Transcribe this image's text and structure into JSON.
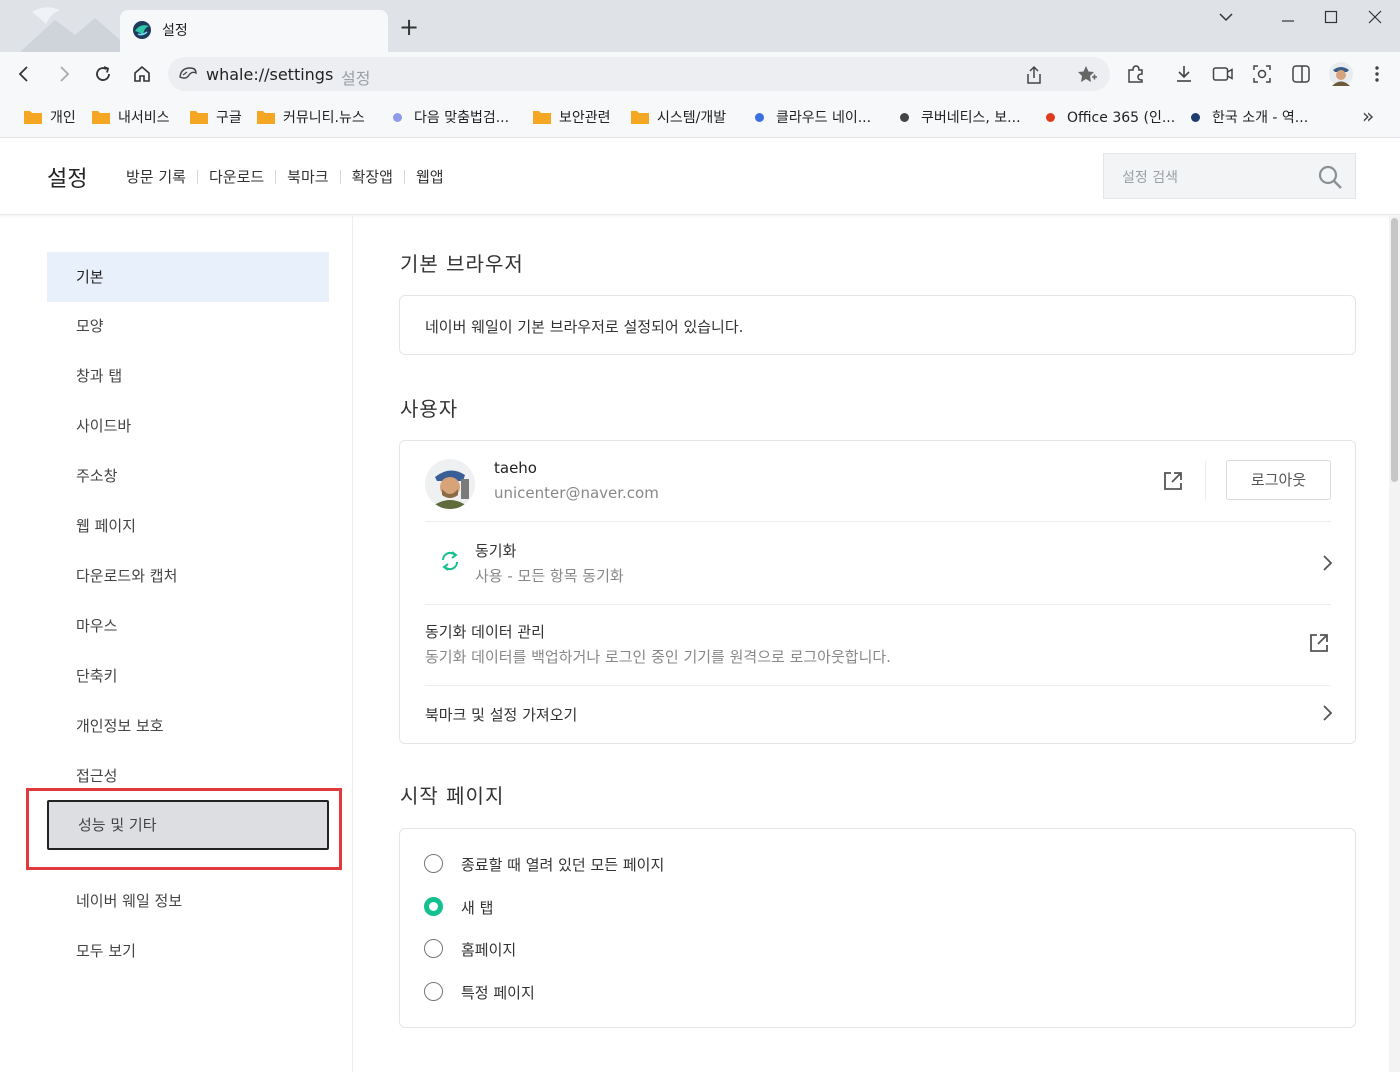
{
  "window": {
    "tab_title": "설정",
    "new_tab": "+"
  },
  "toolbar": {
    "url": "whale://settings",
    "url_suffix": "설정"
  },
  "bookmarks": [
    {
      "label": "개인",
      "kind": "folder"
    },
    {
      "label": "내서비스",
      "kind": "folder"
    },
    {
      "label": "구글",
      "kind": "folder"
    },
    {
      "label": "커뮤니티.뉴스",
      "kind": "folder"
    },
    {
      "label": "다음 맞춤법검...",
      "kind": "dot",
      "color": "#8e9be6"
    },
    {
      "label": "보안관련",
      "kind": "folder"
    },
    {
      "label": "시스템/개발",
      "kind": "folder"
    },
    {
      "label": "클라우드 네이...",
      "kind": "dot",
      "color": "#3b6fe0"
    },
    {
      "label": "쿠버네티스, 보...",
      "kind": "dot",
      "color": "#444444"
    },
    {
      "label": "Office 365 (인...",
      "kind": "dot",
      "color": "#e03a1c"
    },
    {
      "label": "한국 소개 - 역...",
      "kind": "dot",
      "color": "#1d3d6e"
    }
  ],
  "bookmarks_more": "»",
  "settings_header": {
    "title": "설정",
    "nav": [
      "방문 기록",
      "다운로드",
      "북마크",
      "확장앱",
      "웹앱"
    ],
    "search_placeholder": "설정 검색"
  },
  "sidebar": {
    "items": [
      "기본",
      "모양",
      "창과 탭",
      "사이드바",
      "주소창",
      "웹 페이지",
      "다운로드와 캡처",
      "마우스",
      "단축키",
      "개인정보 보호",
      "접근성",
      "성능 및 기타",
      "네이버 웨일 정보",
      "모두 보기"
    ],
    "active": "기본",
    "highlighted": "성능 및 기타"
  },
  "default_browser": {
    "title": "기본 브라우저",
    "status": "네이버 웨일이 기본 브라우저로 설정되어 있습니다."
  },
  "user": {
    "title": "사용자",
    "name": "taeho",
    "email": "unicenter@naver.com",
    "logout": "로그아웃",
    "sync_title": "동기화",
    "sync_sub": "사용 - 모든 항목 동기화",
    "manage_title": "동기화 데이터 관리",
    "manage_sub": "동기화 데이터를 백업하거나 로그인 중인 기기를 원격으로 로그아웃합니다.",
    "import_label": "북마크 및 설정 가져오기"
  },
  "start_page": {
    "title": "시작 페이지",
    "options": [
      "종료할 때 열려 있던 모든 페이지",
      "새 탭",
      "홈페이지",
      "특정 페이지"
    ],
    "selected": "새 탭"
  },
  "colors": {
    "accent": "#13c08f",
    "active_bg": "#e8f0fc",
    "highlight": "#e0393e"
  }
}
